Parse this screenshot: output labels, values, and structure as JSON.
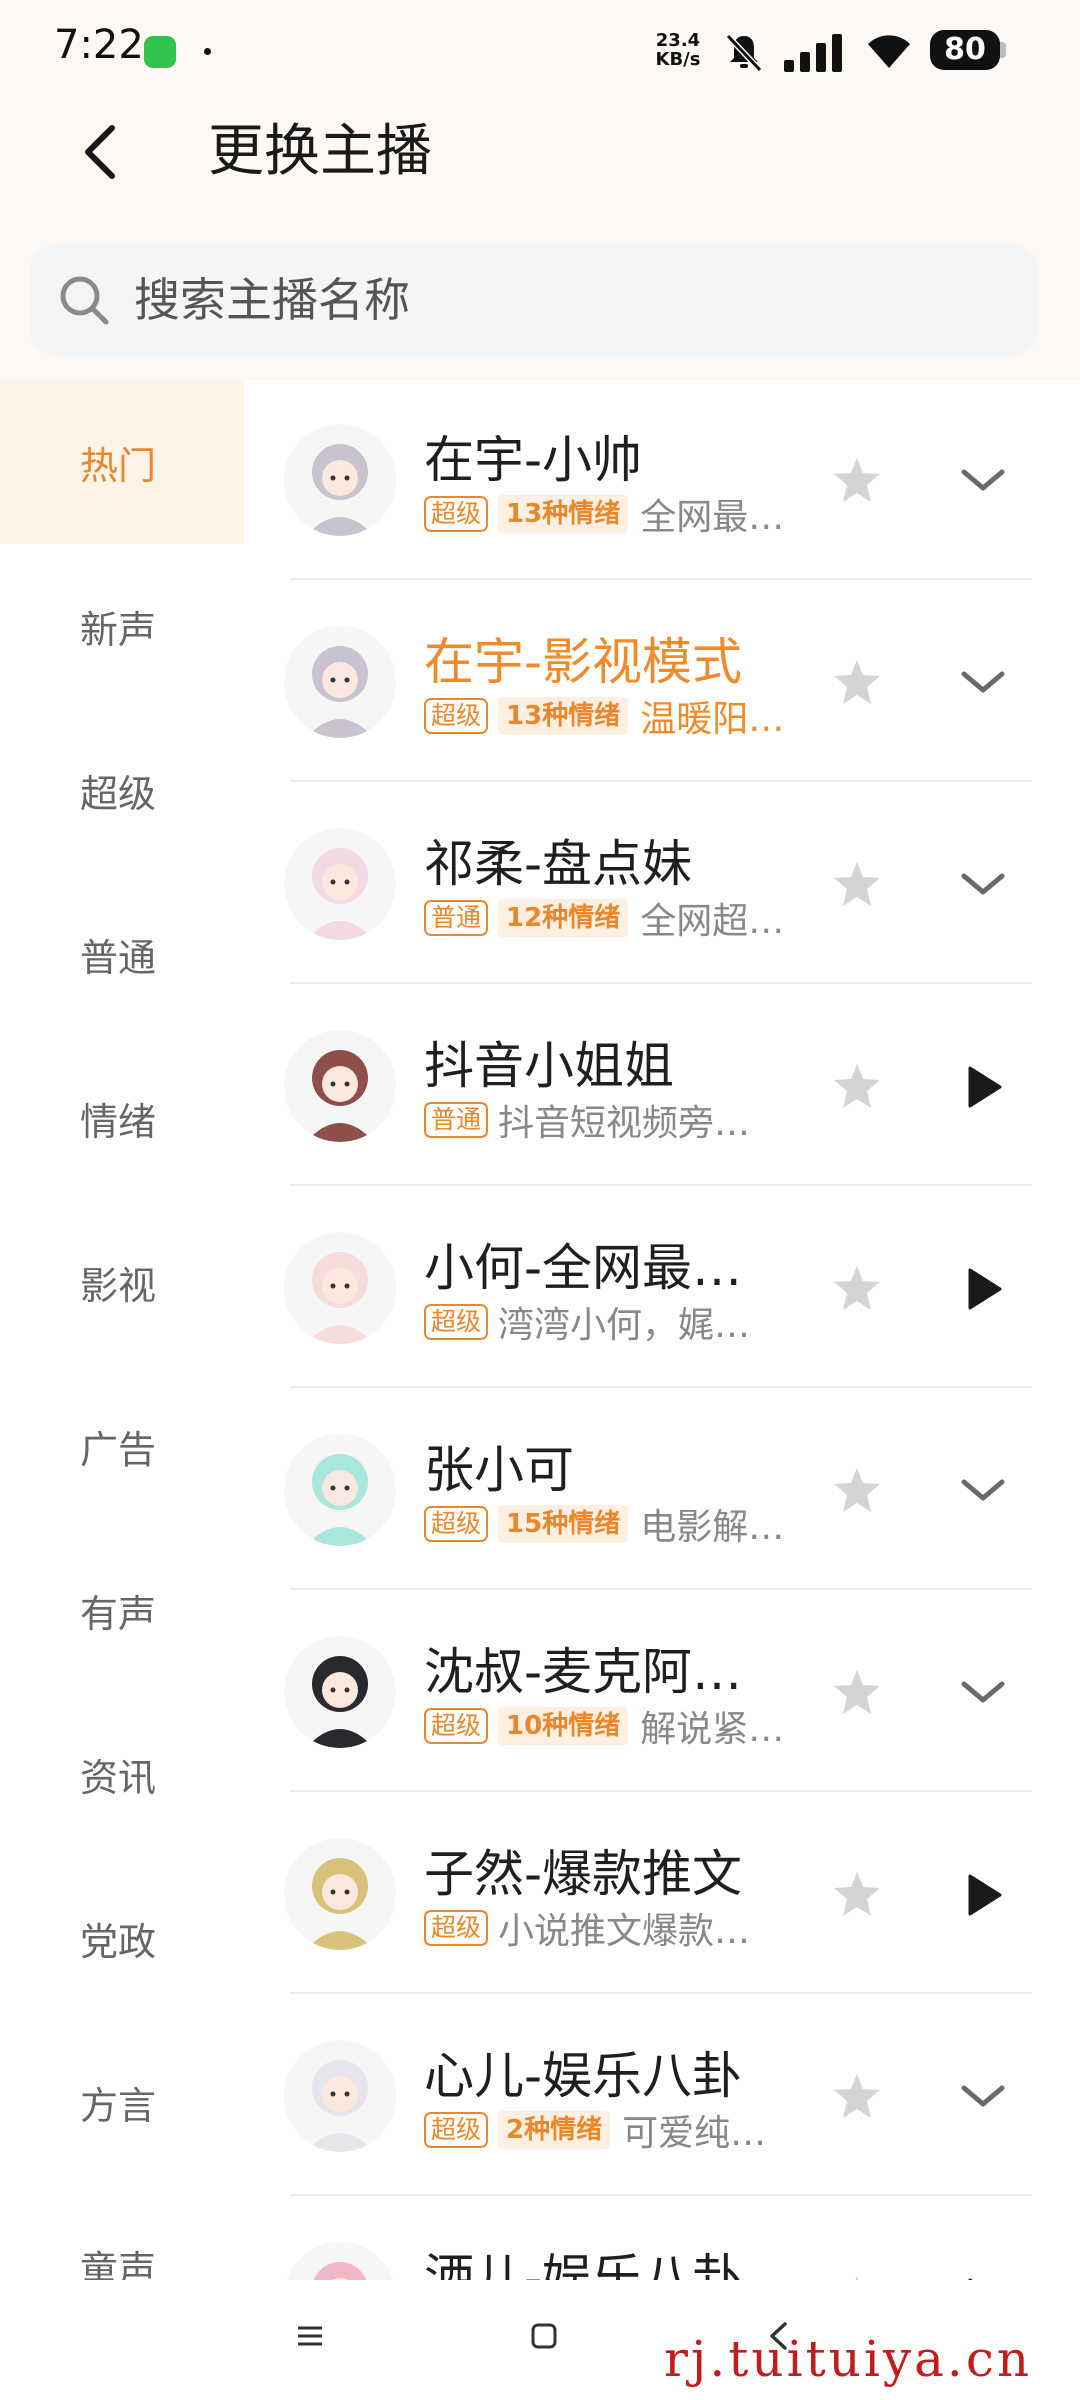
{
  "status_bar": {
    "time": "7:22",
    "net_speed_value": "23.4",
    "net_speed_unit": "KB/s",
    "battery": "80"
  },
  "header": {
    "title": "更换主播"
  },
  "search": {
    "placeholder": "搜索主播名称",
    "value": ""
  },
  "sidebar": {
    "active_index": 0,
    "items": [
      "热门",
      "新声",
      "超级",
      "普通",
      "情绪",
      "影视",
      "广告",
      "有声",
      "资讯",
      "党政",
      "方言",
      "童声"
    ]
  },
  "anchors": [
    {
      "name": "在宇-小帅",
      "tier": "超级",
      "emotions": "13种情绪",
      "desc": "全网最…",
      "action": "expand-icon",
      "highlight": false,
      "avatar_color": "#c9c3cf"
    },
    {
      "name": "在宇-影视模式",
      "tier": "超级",
      "emotions": "13种情绪",
      "desc": "温暖阳…",
      "action": "expand-icon",
      "highlight": true,
      "avatar_color": "#c9c3cf"
    },
    {
      "name": "祁柔-盘点妹",
      "tier": "普通",
      "emotions": "12种情绪",
      "desc": "全网超…",
      "action": "expand-icon",
      "highlight": false,
      "avatar_color": "#f3d9e4"
    },
    {
      "name": "抖音小姐姐",
      "tier": "普通",
      "emotions": "",
      "desc": "抖音短视频旁…",
      "action": "play-icon",
      "highlight": false,
      "avatar_color": "#8e4f4a"
    },
    {
      "name": "小何-全网最…",
      "tier": "超级",
      "emotions": "",
      "desc": "湾湾小何，娓…",
      "action": "play-icon",
      "highlight": false,
      "avatar_color": "#f7dcdc"
    },
    {
      "name": "张小可",
      "tier": "超级",
      "emotions": "15种情绪",
      "desc": "电影解…",
      "action": "expand-icon",
      "highlight": false,
      "avatar_color": "#a9e6dc"
    },
    {
      "name": "沈叔-麦克阿…",
      "tier": "超级",
      "emotions": "10种情绪",
      "desc": "解说紧…",
      "action": "expand-icon",
      "highlight": false,
      "avatar_color": "#2a2a2e"
    },
    {
      "name": "子然-爆款推文",
      "tier": "超级",
      "emotions": "",
      "desc": "小说推文爆款…",
      "action": "play-icon",
      "highlight": false,
      "avatar_color": "#d9c27a"
    },
    {
      "name": "心儿-娱乐八卦",
      "tier": "超级",
      "emotions": "2种情绪",
      "desc": "可爱纯…",
      "action": "expand-icon",
      "highlight": false,
      "avatar_color": "#e7e4ec"
    },
    {
      "name": "洒儿-娱乐八卦",
      "tier": "",
      "emotions": "",
      "desc": "",
      "action": "play-icon",
      "highlight": false,
      "avatar_color": "#f1b9c6"
    }
  ],
  "watermark": "rj.tuituiya.cn",
  "colors": {
    "accent": "#e8872b",
    "header_bg": "#fdf8f3",
    "sidebar_active_bg": "#fef3e7"
  }
}
